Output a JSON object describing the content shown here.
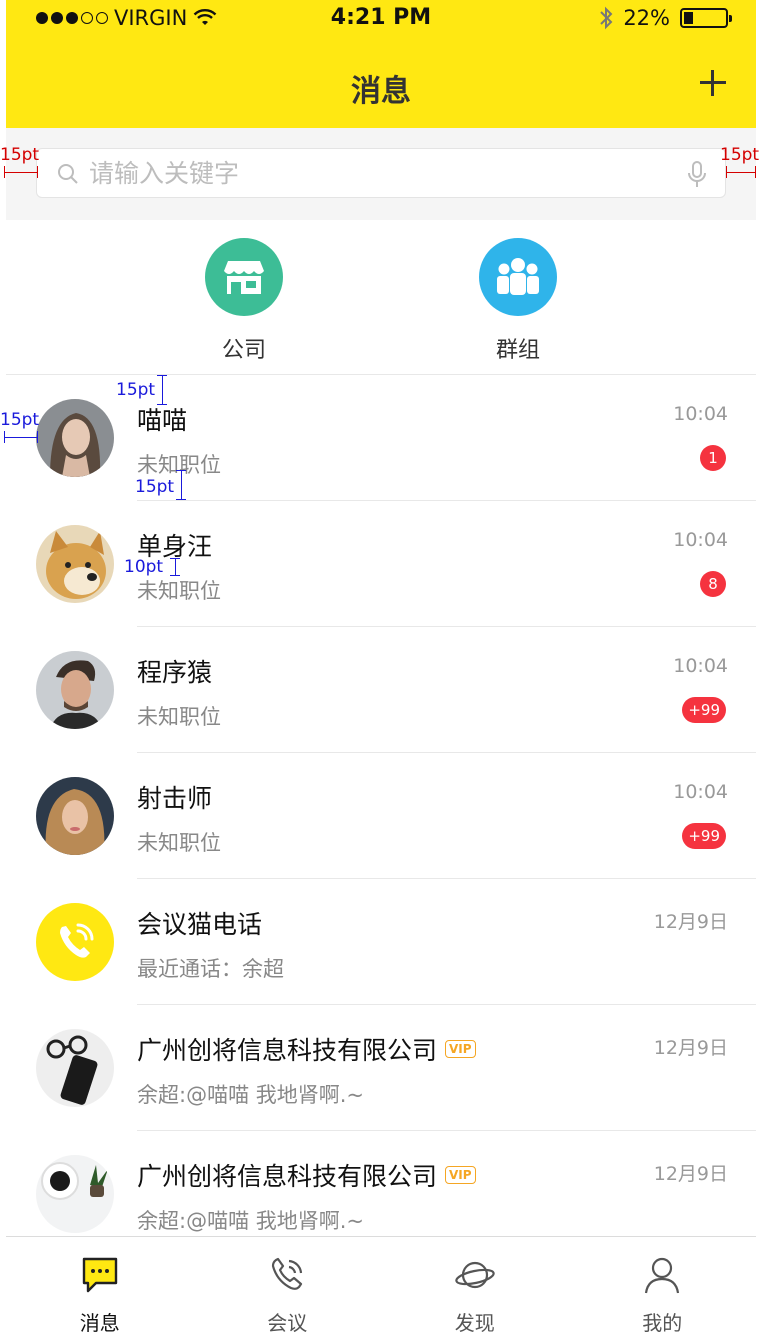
{
  "status_bar": {
    "carrier": "VIRGIN",
    "time": "4:21 PM",
    "battery": "22%",
    "battery_level": 0.22
  },
  "nav": {
    "title": "消息",
    "add_icon": "plus-icon"
  },
  "search": {
    "placeholder": "请输入关键字",
    "icon": "search-icon",
    "voice_icon": "mic-icon"
  },
  "quick_entries": [
    {
      "label": "公司",
      "icon": "store-icon",
      "color": "#3DBD96"
    },
    {
      "label": "群组",
      "icon": "group-icon",
      "color": "#2FB4EA"
    }
  ],
  "conversations": [
    {
      "name": "喵喵",
      "sub": "未知职位",
      "time": "10:04",
      "badge": "1",
      "avatar": "woman-portrait"
    },
    {
      "name": "单身汪",
      "sub": "未知职位",
      "time": "10:04",
      "badge": "8",
      "avatar": "shiba-dog"
    },
    {
      "name": "程序猿",
      "sub": "未知职位",
      "time": "10:04",
      "badge": "+99",
      "avatar": "man-portrait"
    },
    {
      "name": "射击师",
      "sub": "未知职位",
      "time": "10:04",
      "badge": "+99",
      "avatar": "curly-woman-portrait"
    },
    {
      "name": "会议猫电话",
      "sub": "最近通话：余超",
      "time": "12月9日",
      "badge": "",
      "avatar": "phone-call-icon"
    },
    {
      "name": "广州创将信息科技有限公司",
      "vip": "VIP",
      "sub": "余超:@喵喵 我地肾啊.~",
      "time": "12月9日",
      "badge": "",
      "avatar": "desk-phone-glasses"
    },
    {
      "name": "广州创将信息科技有限公司",
      "vip": "VIP",
      "sub": "余超:@喵喵 我地肾啊.~",
      "time": "12月9日",
      "badge": "",
      "avatar": "desk-coffee-plant"
    }
  ],
  "tabs": [
    {
      "label": "消息",
      "icon": "message-icon",
      "active": true
    },
    {
      "label": "会议",
      "icon": "phone-icon",
      "active": false
    },
    {
      "label": "发现",
      "icon": "planet-icon",
      "active": false
    },
    {
      "label": "我的",
      "icon": "user-icon",
      "active": false
    }
  ],
  "annotations": {
    "search_left": "15pt",
    "search_right": "15pt",
    "row_top": "15pt",
    "avatar_left": "15pt",
    "avatar_text_gap": "15pt",
    "name_sub_gap": "10pt"
  },
  "colors": {
    "brand_yellow": "#FFE812",
    "badge_red": "#F5333F",
    "vip_orange": "#F5A623"
  }
}
